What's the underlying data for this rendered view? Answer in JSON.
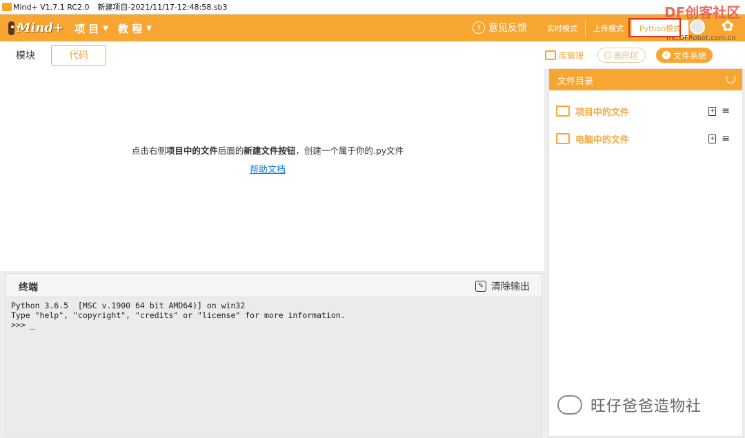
{
  "titlebar": {
    "app": "Mind+ V1.7.1 RC2.0",
    "file": "新建项目-2021/11/17-12:48:58.sb3"
  },
  "menubar": {
    "logo": "Mind+",
    "menu_project": "项 目",
    "menu_tutorial": "教 程",
    "feedback": "意见反馈",
    "modes": [
      "实时模式",
      "上传模式",
      "Python模式"
    ],
    "active_mode": "Python模式",
    "watermark": "DF创客社区",
    "watermark_url": "mc.DFRobot.com.cn"
  },
  "subbar": {
    "tabs": [
      "模块",
      "代码"
    ],
    "lib_label": "库管理",
    "graph_label": "图形区",
    "fs_label": "文件系统"
  },
  "editor": {
    "hint_pre": "点击右侧",
    "hint_b1": "项目中的文件",
    "hint_mid": "后面的",
    "hint_b2": "新建文件按钮",
    "hint_post": "，创建一个属于你的.py文件",
    "help_link": "帮助文档"
  },
  "terminal": {
    "title": "终端",
    "clear_label": "清除输出",
    "lines": [
      "Python 3.6.5  [MSC v.1900 64 bit AMD64)] on win32",
      "Type \"help\", \"copyright\", \"credits\" or \"license\" for more information.",
      ">>> _"
    ]
  },
  "files": {
    "title": "文件目录",
    "items": [
      {
        "label": "项目中的文件"
      },
      {
        "label": "电脑中的文件"
      }
    ]
  },
  "footer_watermark": "旺仔爸爸造物社"
}
